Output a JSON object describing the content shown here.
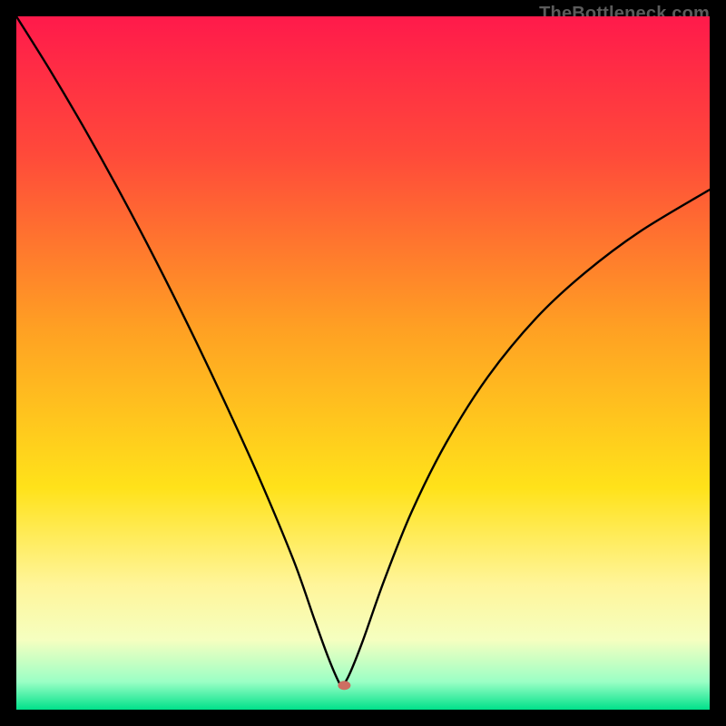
{
  "watermark": "TheBottleneck.com",
  "chart_data": {
    "type": "line",
    "title": "",
    "xlabel": "",
    "ylabel": "",
    "xlim": [
      0,
      100
    ],
    "ylim": [
      0,
      100
    ],
    "gradient_stops": [
      {
        "offset": 0,
        "color": "#ff1a4b"
      },
      {
        "offset": 20,
        "color": "#ff4a3a"
      },
      {
        "offset": 45,
        "color": "#ffa023"
      },
      {
        "offset": 68,
        "color": "#ffe21a"
      },
      {
        "offset": 82,
        "color": "#fff59a"
      },
      {
        "offset": 90,
        "color": "#f5ffc0"
      },
      {
        "offset": 96,
        "color": "#9affc5"
      },
      {
        "offset": 100,
        "color": "#00e18a"
      }
    ],
    "curve": {
      "description": "V-shaped smooth curve with minimum near x≈47, right branch asymptotically rising",
      "min_x": 47,
      "min_y": 3.5,
      "points": [
        {
          "x": 0.0,
          "y": 100.0
        },
        {
          "x": 5.0,
          "y": 92.0
        },
        {
          "x": 10.0,
          "y": 83.5
        },
        {
          "x": 15.0,
          "y": 74.5
        },
        {
          "x": 20.0,
          "y": 65.0
        },
        {
          "x": 25.0,
          "y": 55.0
        },
        {
          "x": 30.0,
          "y": 44.5
        },
        {
          "x": 35.0,
          "y": 33.5
        },
        {
          "x": 40.0,
          "y": 21.5
        },
        {
          "x": 43.0,
          "y": 13.0
        },
        {
          "x": 45.0,
          "y": 7.5
        },
        {
          "x": 46.5,
          "y": 4.0
        },
        {
          "x": 47.0,
          "y": 3.5
        },
        {
          "x": 48.0,
          "y": 5.0
        },
        {
          "x": 50.0,
          "y": 10.0
        },
        {
          "x": 53.0,
          "y": 18.5
        },
        {
          "x": 57.0,
          "y": 28.5
        },
        {
          "x": 62.0,
          "y": 38.5
        },
        {
          "x": 68.0,
          "y": 48.0
        },
        {
          "x": 75.0,
          "y": 56.5
        },
        {
          "x": 82.0,
          "y": 63.0
        },
        {
          "x": 90.0,
          "y": 69.0
        },
        {
          "x": 100.0,
          "y": 75.0
        }
      ]
    },
    "marker": {
      "x": 47.3,
      "y": 3.5,
      "rx": 7,
      "ry": 5,
      "fill": "#cd6e62"
    }
  }
}
